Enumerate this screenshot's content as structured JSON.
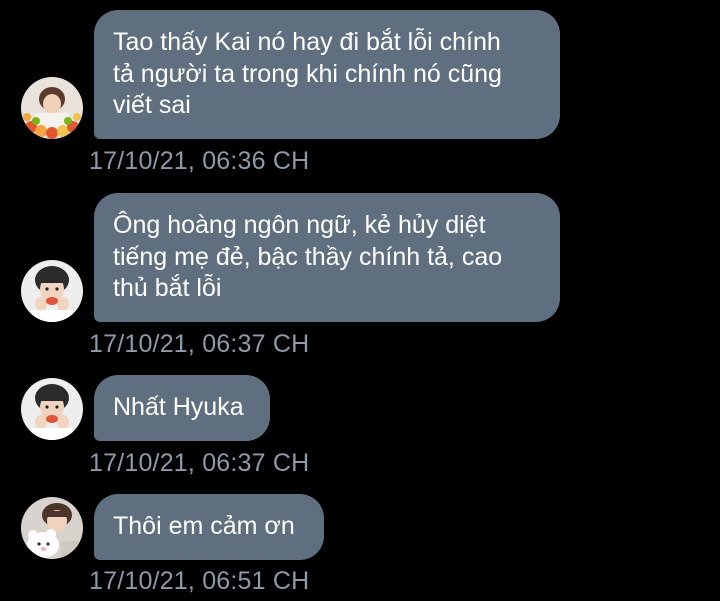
{
  "messages": [
    {
      "avatar": "avatar-flowers-icon",
      "lines": [
        "Tao thấy Kai nó hay đi bắt lỗi chính",
        "tả người ta trong khi chính nó cũng",
        "viết sai"
      ],
      "timestamp": "17/10/21, 06:36 CH"
    },
    {
      "avatar": "avatar-boy-icon",
      "lines": [
        "Ông hoàng ngôn ngữ, kẻ hủy diệt",
        "tiếng mẹ đẻ, bậc thầy chính tả, cao",
        "thủ bắt lỗi"
      ],
      "timestamp": "17/10/21, 06:37 CH"
    },
    {
      "avatar": "avatar-boy-icon",
      "lines": [
        "Nhất Hyuka"
      ],
      "timestamp": "17/10/21, 06:37 CH"
    },
    {
      "avatar": "avatar-plush-icon",
      "lines": [
        "Thôi em cảm ơn"
      ],
      "timestamp": "17/10/21, 06:51 CH"
    }
  ],
  "colors": {
    "background": "#000000",
    "bubble": "#5f6f80",
    "bubble_text": "#ffffff",
    "timestamp_text": "#8e9aa7"
  }
}
